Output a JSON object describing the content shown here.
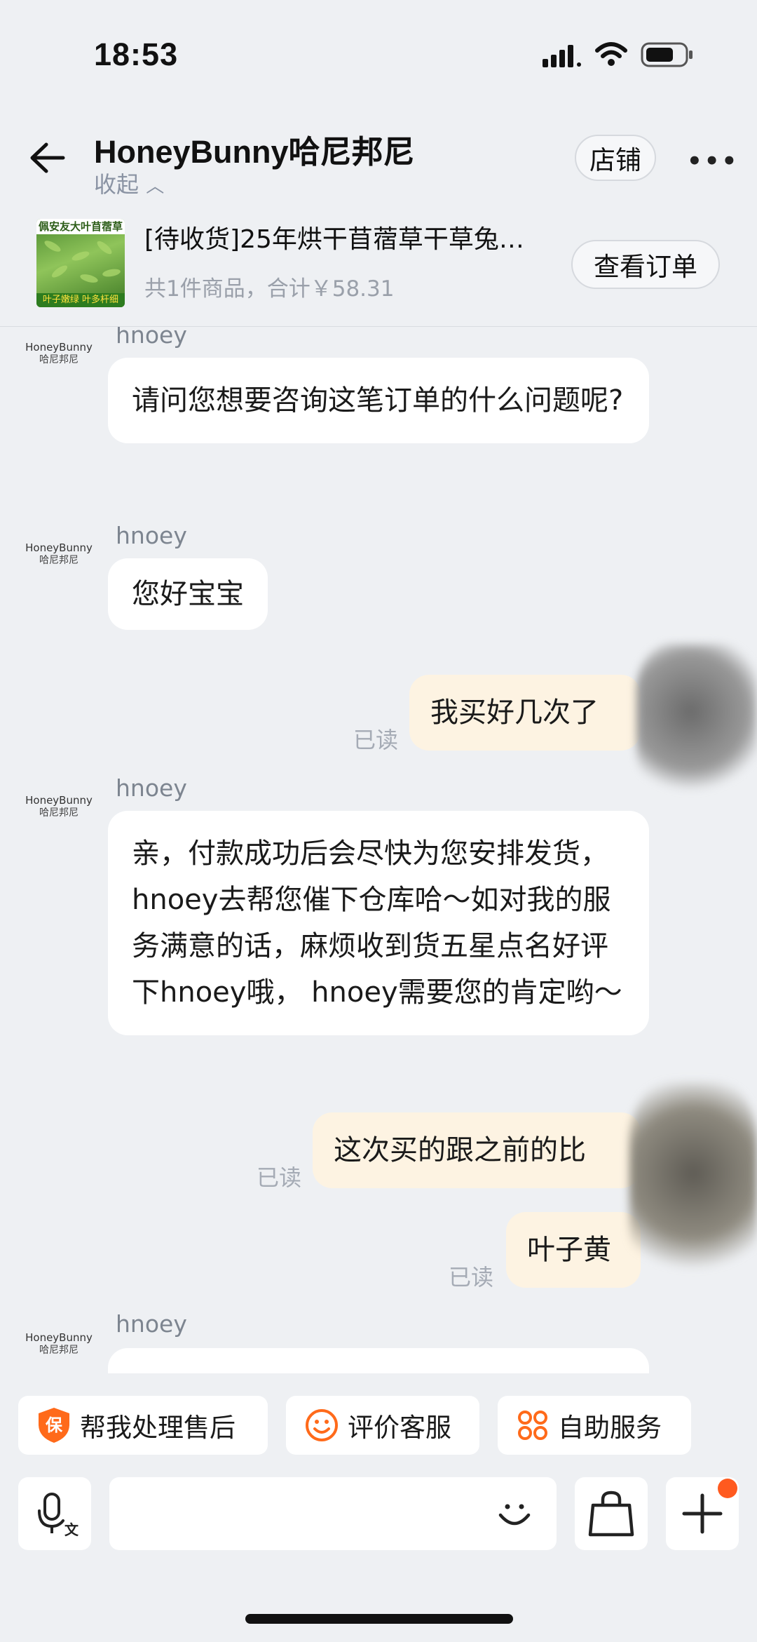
{
  "status_bar": {
    "time": "18:53"
  },
  "header": {
    "title": "HoneyBunny哈尼邦尼",
    "collapse_label": "收起",
    "store_button": "店铺"
  },
  "order": {
    "thumb_top_text": "佩安友大叶苜蓿草",
    "thumb_bottom_text": "叶子嫩绿 叶多杆细",
    "title": "[待收货]25年烘干苜蓿草干草兔…",
    "summary": "共1件商品，合计￥58.31",
    "view_button": "查看订单"
  },
  "shop_logo": {
    "line1": "HoneyBunny",
    "line2": "哈尼邦尼"
  },
  "messages": [
    {
      "side": "left",
      "sender": "hnoey",
      "text": "请问您想要咨询这笔订单的什么问题呢?"
    },
    {
      "side": "left",
      "sender": "hnoey",
      "text": "您好宝宝"
    },
    {
      "side": "right",
      "status": "已读",
      "text": "我买好几次了"
    },
    {
      "side": "left",
      "sender": "hnoey",
      "text": "亲，付款成功后会尽快为您安排发货，hnoey去帮您催下仓库哈～如对我的服务满意的话，麻烦收到货五星点名好评下hnoey哦， hnoey需要您的肯定哟～"
    },
    {
      "side": "right",
      "status": "已读",
      "text": "这次买的跟之前的比"
    },
    {
      "side": "right",
      "status": "已读",
      "text": "叶子黄"
    },
    {
      "side": "left",
      "sender": "hnoey",
      "text": ""
    }
  ],
  "quick_actions": [
    {
      "label": "帮我处理售后",
      "icon": "shield-bao-icon"
    },
    {
      "label": "评价客服",
      "icon": "smiley-icon"
    },
    {
      "label": "自助服务",
      "icon": "grid-service-icon"
    }
  ],
  "input_bar": {
    "voice_icon": "voice-translate-icon",
    "emoji_icon": "emoji-icon",
    "bag_icon": "shopping-bag-icon",
    "plus_icon": "plus-icon",
    "accent": "#ff5a1f"
  }
}
